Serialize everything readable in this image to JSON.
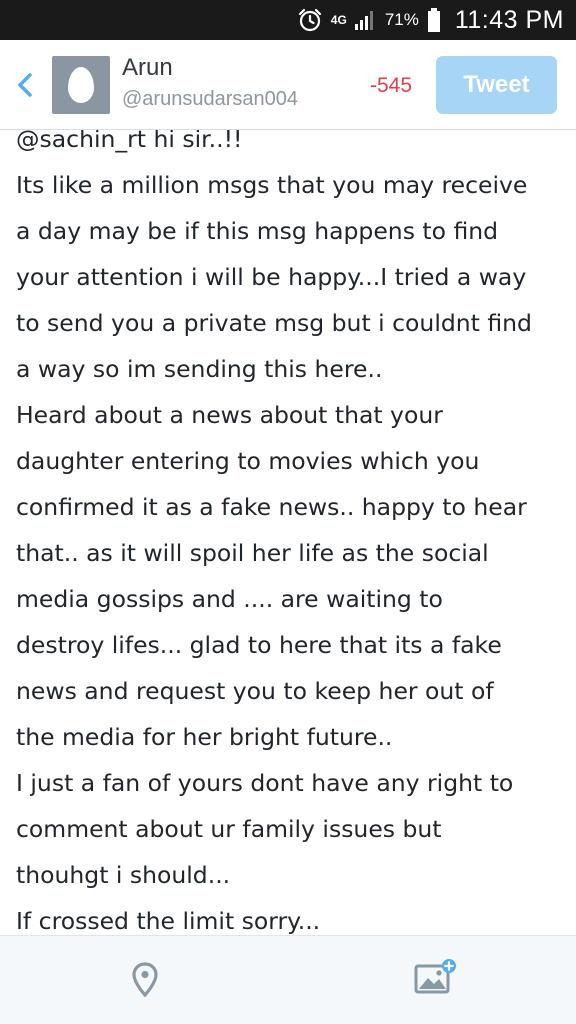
{
  "status_bar": {
    "network": "4G",
    "battery": "71%",
    "time": "11:43 PM",
    "icons": [
      "alarm-clock-icon",
      "signal-icon",
      "battery-icon"
    ]
  },
  "header": {
    "name": "Arun",
    "handle": "@arunsudarsan004",
    "char_count": "-545",
    "tweet_label": "Tweet",
    "accent_color": "#55acee",
    "warning_color": "#e0404b"
  },
  "compose": {
    "lines": [
      "@sachin_rt  hi sir..!!",
      "Its like a million msgs that you may receive",
      "a day may be if this msg happens to find",
      "your attention i will be happy...I tried a way",
      "to send you a private msg but i couldnt find",
      "a way so im sending this here..",
      "Heard about a news about that your",
      "daughter entering to movies which you",
      "confirmed it as a fake news.. happy to hear",
      "that.. as it will spoil her life as the social",
      "media gossips and .... are waiting to",
      "destroy lifes... glad to here that its a fake",
      "news and request you to keep her out of",
      "the media for her bright future..",
      "I just a fan of yours dont have any right to",
      "comment about ur family issues but",
      "thouhgt  i should...",
      "If crossed the limit sorry..."
    ]
  },
  "bottom_bar": {
    "icons": [
      "location-pin-icon",
      "add-photo-icon"
    ]
  }
}
